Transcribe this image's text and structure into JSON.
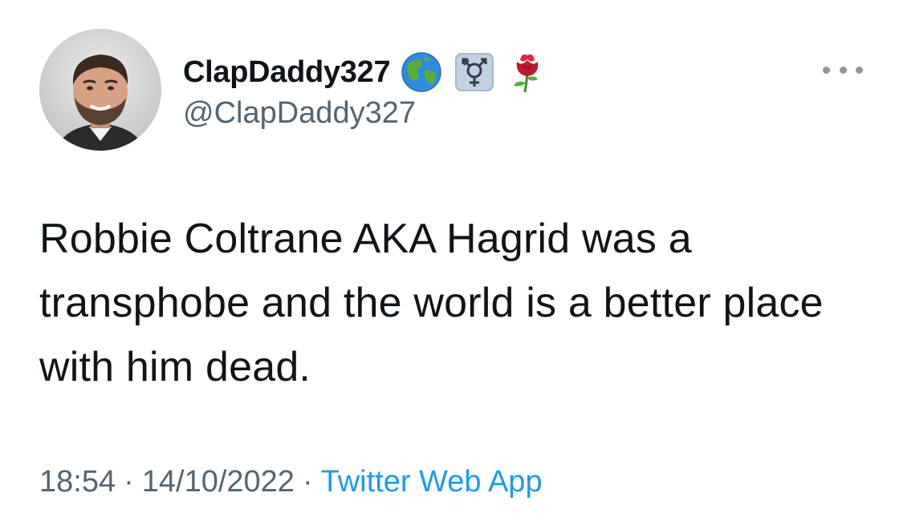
{
  "user": {
    "display_name": "ClapDaddy327",
    "handle": "@ClapDaddy327",
    "badges": [
      "globe-icon",
      "transgender-symbol-icon",
      "rose-icon"
    ]
  },
  "tweet": {
    "text": "Robbie Coltrane AKA Hagrid was a transphobe and the world is a better place with him dead.",
    "time": "18:54",
    "date": "14/10/2022",
    "separator": "·",
    "source": "Twitter Web App"
  },
  "colors": {
    "text": "#0f1419",
    "secondary": "#536471",
    "link": "#1d9bf0"
  }
}
